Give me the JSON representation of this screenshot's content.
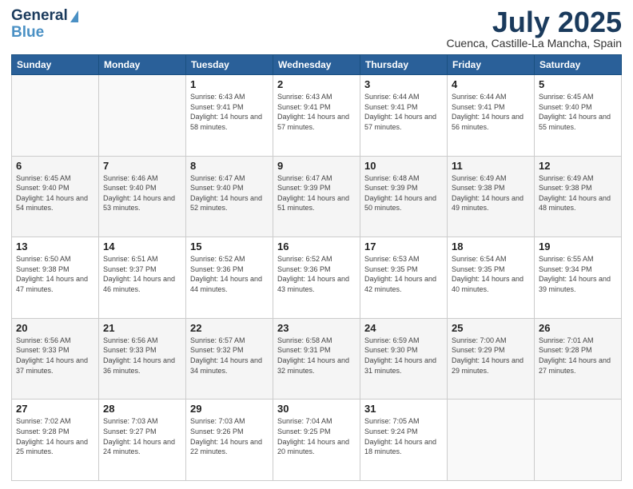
{
  "header": {
    "logo_line1": "General",
    "logo_line2": "Blue",
    "month_title": "July 2025",
    "subtitle": "Cuenca, Castille-La Mancha, Spain"
  },
  "days_of_week": [
    "Sunday",
    "Monday",
    "Tuesday",
    "Wednesday",
    "Thursday",
    "Friday",
    "Saturday"
  ],
  "weeks": [
    {
      "days": [
        {
          "num": "",
          "info": ""
        },
        {
          "num": "",
          "info": ""
        },
        {
          "num": "1",
          "info": "Sunrise: 6:43 AM\nSunset: 9:41 PM\nDaylight: 14 hours and 58 minutes."
        },
        {
          "num": "2",
          "info": "Sunrise: 6:43 AM\nSunset: 9:41 PM\nDaylight: 14 hours and 57 minutes."
        },
        {
          "num": "3",
          "info": "Sunrise: 6:44 AM\nSunset: 9:41 PM\nDaylight: 14 hours and 57 minutes."
        },
        {
          "num": "4",
          "info": "Sunrise: 6:44 AM\nSunset: 9:41 PM\nDaylight: 14 hours and 56 minutes."
        },
        {
          "num": "5",
          "info": "Sunrise: 6:45 AM\nSunset: 9:40 PM\nDaylight: 14 hours and 55 minutes."
        }
      ]
    },
    {
      "days": [
        {
          "num": "6",
          "info": "Sunrise: 6:45 AM\nSunset: 9:40 PM\nDaylight: 14 hours and 54 minutes."
        },
        {
          "num": "7",
          "info": "Sunrise: 6:46 AM\nSunset: 9:40 PM\nDaylight: 14 hours and 53 minutes."
        },
        {
          "num": "8",
          "info": "Sunrise: 6:47 AM\nSunset: 9:40 PM\nDaylight: 14 hours and 52 minutes."
        },
        {
          "num": "9",
          "info": "Sunrise: 6:47 AM\nSunset: 9:39 PM\nDaylight: 14 hours and 51 minutes."
        },
        {
          "num": "10",
          "info": "Sunrise: 6:48 AM\nSunset: 9:39 PM\nDaylight: 14 hours and 50 minutes."
        },
        {
          "num": "11",
          "info": "Sunrise: 6:49 AM\nSunset: 9:38 PM\nDaylight: 14 hours and 49 minutes."
        },
        {
          "num": "12",
          "info": "Sunrise: 6:49 AM\nSunset: 9:38 PM\nDaylight: 14 hours and 48 minutes."
        }
      ]
    },
    {
      "days": [
        {
          "num": "13",
          "info": "Sunrise: 6:50 AM\nSunset: 9:38 PM\nDaylight: 14 hours and 47 minutes."
        },
        {
          "num": "14",
          "info": "Sunrise: 6:51 AM\nSunset: 9:37 PM\nDaylight: 14 hours and 46 minutes."
        },
        {
          "num": "15",
          "info": "Sunrise: 6:52 AM\nSunset: 9:36 PM\nDaylight: 14 hours and 44 minutes."
        },
        {
          "num": "16",
          "info": "Sunrise: 6:52 AM\nSunset: 9:36 PM\nDaylight: 14 hours and 43 minutes."
        },
        {
          "num": "17",
          "info": "Sunrise: 6:53 AM\nSunset: 9:35 PM\nDaylight: 14 hours and 42 minutes."
        },
        {
          "num": "18",
          "info": "Sunrise: 6:54 AM\nSunset: 9:35 PM\nDaylight: 14 hours and 40 minutes."
        },
        {
          "num": "19",
          "info": "Sunrise: 6:55 AM\nSunset: 9:34 PM\nDaylight: 14 hours and 39 minutes."
        }
      ]
    },
    {
      "days": [
        {
          "num": "20",
          "info": "Sunrise: 6:56 AM\nSunset: 9:33 PM\nDaylight: 14 hours and 37 minutes."
        },
        {
          "num": "21",
          "info": "Sunrise: 6:56 AM\nSunset: 9:33 PM\nDaylight: 14 hours and 36 minutes."
        },
        {
          "num": "22",
          "info": "Sunrise: 6:57 AM\nSunset: 9:32 PM\nDaylight: 14 hours and 34 minutes."
        },
        {
          "num": "23",
          "info": "Sunrise: 6:58 AM\nSunset: 9:31 PM\nDaylight: 14 hours and 32 minutes."
        },
        {
          "num": "24",
          "info": "Sunrise: 6:59 AM\nSunset: 9:30 PM\nDaylight: 14 hours and 31 minutes."
        },
        {
          "num": "25",
          "info": "Sunrise: 7:00 AM\nSunset: 9:29 PM\nDaylight: 14 hours and 29 minutes."
        },
        {
          "num": "26",
          "info": "Sunrise: 7:01 AM\nSunset: 9:28 PM\nDaylight: 14 hours and 27 minutes."
        }
      ]
    },
    {
      "days": [
        {
          "num": "27",
          "info": "Sunrise: 7:02 AM\nSunset: 9:28 PM\nDaylight: 14 hours and 25 minutes."
        },
        {
          "num": "28",
          "info": "Sunrise: 7:03 AM\nSunset: 9:27 PM\nDaylight: 14 hours and 24 minutes."
        },
        {
          "num": "29",
          "info": "Sunrise: 7:03 AM\nSunset: 9:26 PM\nDaylight: 14 hours and 22 minutes."
        },
        {
          "num": "30",
          "info": "Sunrise: 7:04 AM\nSunset: 9:25 PM\nDaylight: 14 hours and 20 minutes."
        },
        {
          "num": "31",
          "info": "Sunrise: 7:05 AM\nSunset: 9:24 PM\nDaylight: 14 hours and 18 minutes."
        },
        {
          "num": "",
          "info": ""
        },
        {
          "num": "",
          "info": ""
        }
      ]
    }
  ]
}
